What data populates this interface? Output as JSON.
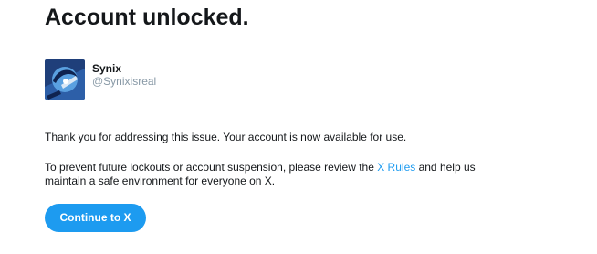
{
  "page": {
    "title": "Account unlocked."
  },
  "account": {
    "display_name": "Synix",
    "handle": "@Synixisreal",
    "avatar_icon": "avatar-image"
  },
  "message": {
    "line1": "Thank you for addressing this issue. Your account is now available for use.",
    "line2_before_link": "To prevent future lockouts or account suspension, please review the ",
    "link_text": "X Rules",
    "line2_after_link": " and help us",
    "line3": "maintain a safe environment for everyone on X."
  },
  "actions": {
    "continue_label": "Continue to X"
  },
  "colors": {
    "accent": "#1d9bf0",
    "text": "#14171a",
    "muted": "#8899a6"
  }
}
